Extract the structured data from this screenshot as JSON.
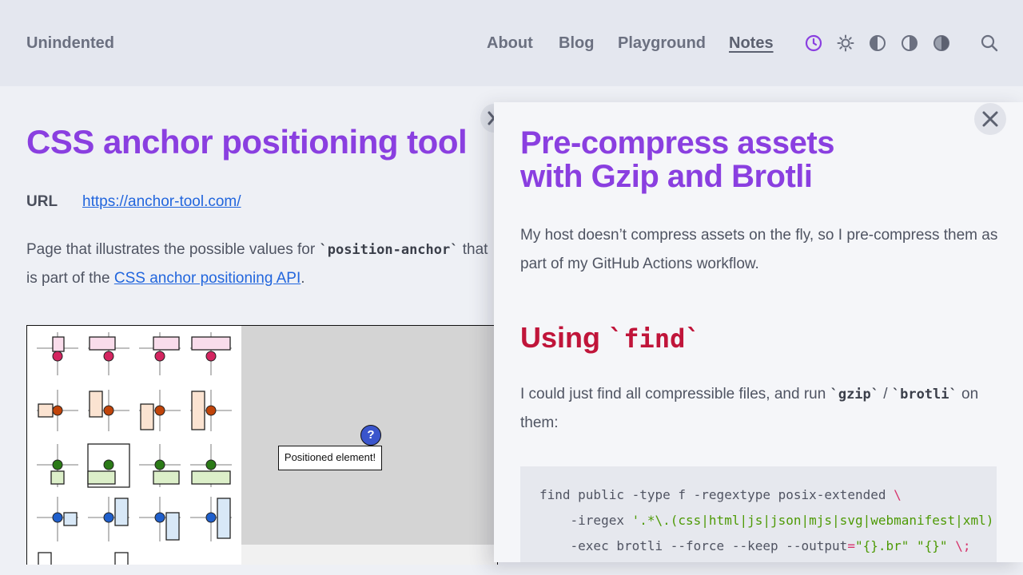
{
  "header": {
    "brand": "Unindented",
    "nav": [
      {
        "label": "About",
        "active": false
      },
      {
        "label": "Blog",
        "active": false
      },
      {
        "label": "Playground",
        "active": false
      },
      {
        "label": "Notes",
        "active": true
      }
    ],
    "icons": [
      "clock-icon",
      "sun-icon",
      "half-circle-icon",
      "half-circle-icon",
      "half-circle-icon",
      "search-icon"
    ],
    "accent": "#8a3fe0"
  },
  "left_note": {
    "title": "CSS anchor positioning tool",
    "url_label": "URL",
    "url": "https://anchor-tool.com/",
    "para_before": "Page that illustrates the possible values for ",
    "para_code": "`position-anchor`",
    "para_mid": " that is part of the ",
    "para_link": "CSS anchor positioning API",
    "para_after": ".",
    "demo": {
      "positioned_label": "Positioned element!",
      "q_mark": "?"
    }
  },
  "right_note": {
    "title_line1": "Pre-compress assets",
    "title_line2": "with Gzip and Brotli",
    "para1": "My host doesn’t compress assets on the fly, so I pre-compress them as part of my GitHub Actions workflow.",
    "section_word": "Using ",
    "section_code": "`find`",
    "para2_before": "I could just find all compressible files, and run ",
    "para2_code1": "`gzip`",
    "para2_sep": " / ",
    "para2_code2": "`brotli`",
    "para2_after": " on them:",
    "code": {
      "line1": "find public -type f -regextype posix-extended ",
      "line1_cont": "\\",
      "line2_flag": "    -iregex ",
      "line2_str": "'.*\\.(css|html|js|json|mjs|svg|webmanifest|xml)",
      "line3_a": "    -exec brotli --force --keep --output",
      "line3_eq": "=",
      "line3_str1": "\"{}.br\"",
      "line3_sp": " ",
      "line3_str2": "\"{}\"",
      "line3_end": " \\;"
    }
  }
}
